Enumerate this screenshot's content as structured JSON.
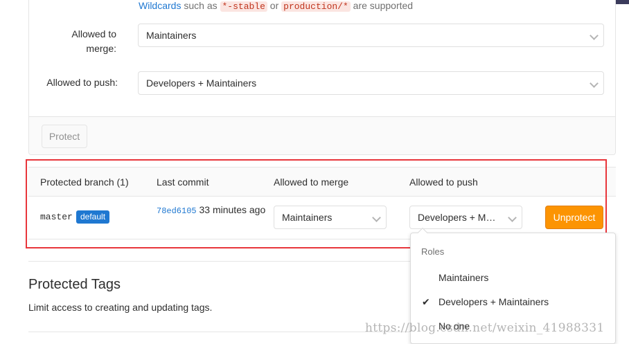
{
  "hint": {
    "prefix": "Wildcards",
    "mid1": " such as ",
    "code1": "*-stable",
    "mid2": " or ",
    "code2": "production/*",
    "suffix": " are supported"
  },
  "form": {
    "merge_label": "Allowed to merge:",
    "merge_value": "Maintainers",
    "push_label": "Allowed to push:",
    "push_value": "Developers + Maintainers",
    "protect_button": "Protect"
  },
  "table": {
    "headers": [
      "Protected branch (1)",
      "Last commit",
      "Allowed to merge",
      "Allowed to push"
    ],
    "row": {
      "branch": "master",
      "badge": "default",
      "commit_sha": "78ed6105",
      "commit_time": "33 minutes ago",
      "merge_value": "Maintainers",
      "push_value": "Developers + Maintainers",
      "unprotect_button": "Unprotect"
    }
  },
  "tags_section": {
    "title": "Protected Tags",
    "description": "Limit access to creating and updating tags."
  },
  "dropdown": {
    "header": "Roles",
    "items": [
      {
        "label": "Maintainers",
        "checked": false
      },
      {
        "label": "Developers + Maintainers",
        "checked": true
      },
      {
        "label": "No one",
        "checked": false
      }
    ],
    "check_icon": "check-icon"
  },
  "watermark": "https://blog.csdn.net/weixin_41988331",
  "colors": {
    "link": "#1f78d1",
    "unprotect": "#fc9403",
    "highlight": "#e8353a"
  }
}
